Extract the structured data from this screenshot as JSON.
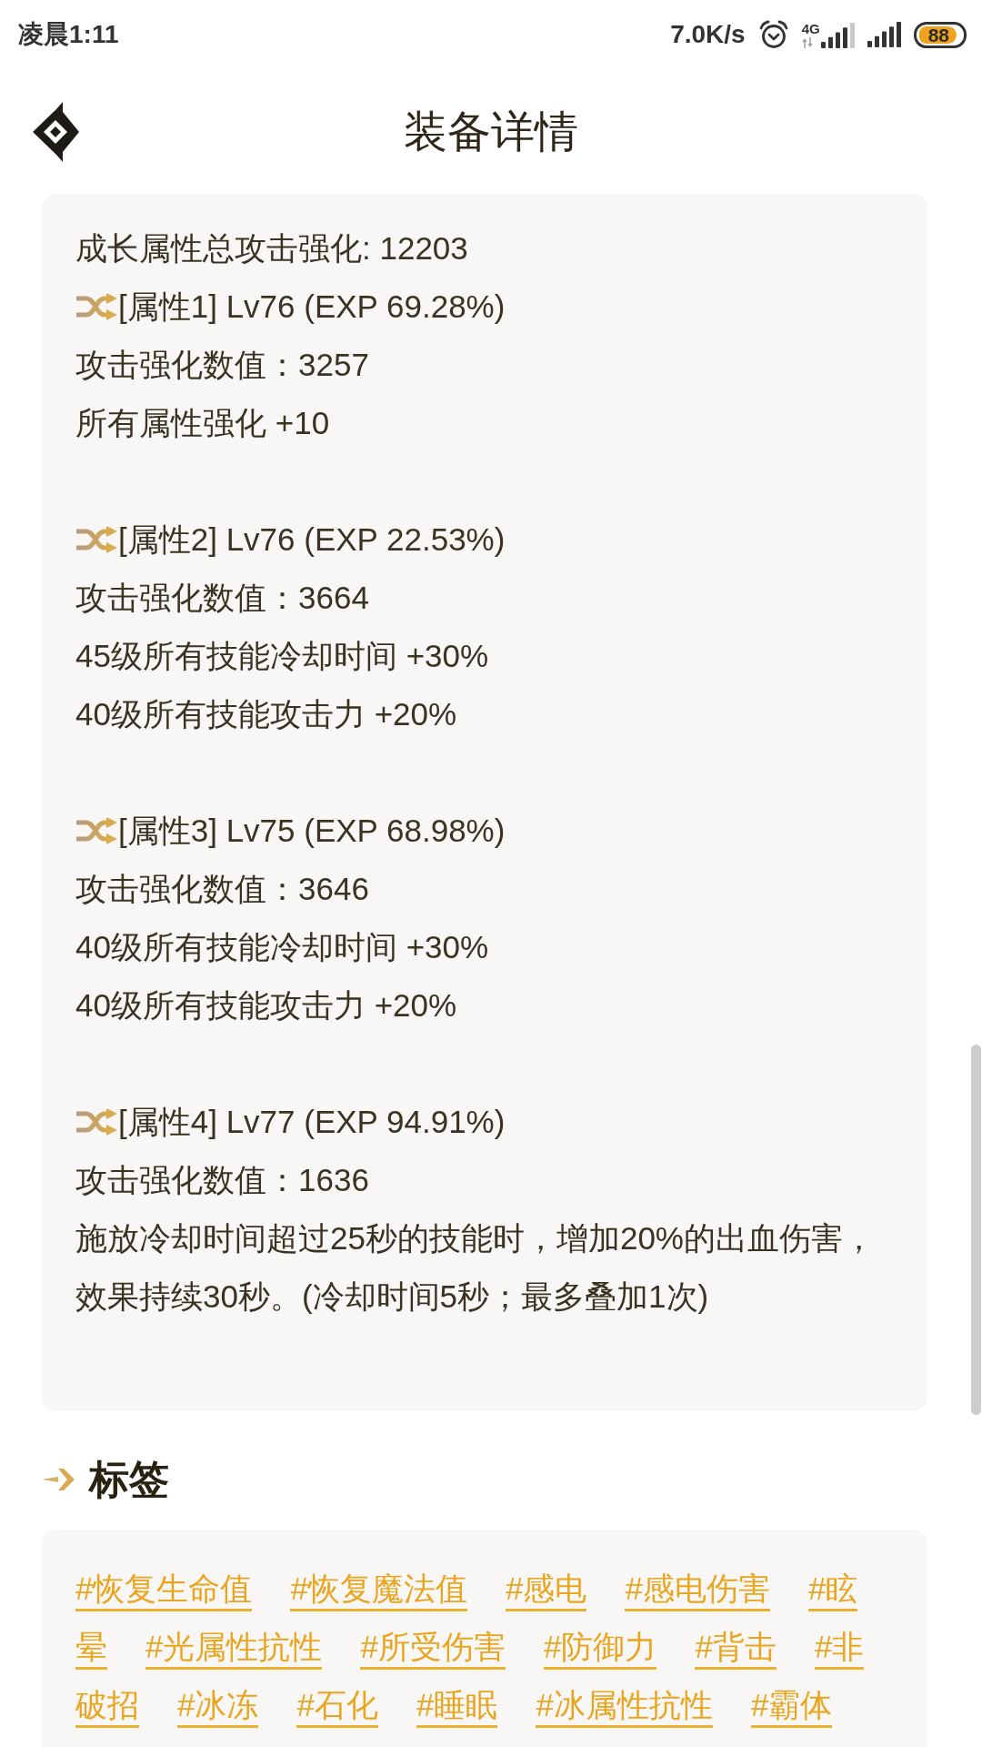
{
  "status_bar": {
    "time": "凌晨1:11",
    "network_speed": "7.0K/s",
    "network_type": "4G",
    "battery": "88"
  },
  "header": {
    "title": "装备详情"
  },
  "growth_card": {
    "total": "成长属性总攻击强化: 12203",
    "attributes": [
      {
        "title": "[属性1] Lv76 (EXP 69.28%)",
        "lines": [
          "攻击强化数值：3257",
          "所有属性强化 +10"
        ]
      },
      {
        "title": "[属性2] Lv76 (EXP 22.53%)",
        "lines": [
          "攻击强化数值：3664",
          "45级所有技能冷却时间 +30%",
          "40级所有技能攻击力 +20%"
        ]
      },
      {
        "title": "[属性3] Lv75 (EXP 68.98%)",
        "lines": [
          "攻击强化数值：3646",
          "40级所有技能冷却时间 +30%",
          "40级所有技能攻击力 +20%"
        ]
      },
      {
        "title": "[属性4] Lv77 (EXP 94.91%)",
        "lines": [
          "攻击强化数值：1636",
          "施放冷却时间超过25秒的技能时，增加20%的出血伤害，效果持续30秒。(冷却时间5秒；最多叠加1次)"
        ]
      }
    ]
  },
  "tags_section": {
    "title": "标签",
    "tags": [
      {
        "parts": [
          "#恢复生命值"
        ]
      },
      {
        "parts": [
          "#恢复魔法值"
        ]
      },
      {
        "parts": [
          "#感电"
        ]
      },
      {
        "parts": [
          "#感电伤害"
        ]
      },
      {
        "parts": [
          "#眩",
          "晕"
        ]
      },
      {
        "parts": [
          "#光属性抗性"
        ]
      },
      {
        "parts": [
          "#所受伤害"
        ]
      },
      {
        "parts": [
          "#防御力"
        ]
      },
      {
        "parts": [
          "#背击"
        ]
      },
      {
        "parts": [
          "#非",
          "破招"
        ]
      },
      {
        "parts": [
          "#冰冻"
        ]
      },
      {
        "parts": [
          "#石化"
        ]
      },
      {
        "parts": [
          "#睡眠"
        ]
      },
      {
        "parts": [
          "#冰属性抗性"
        ]
      },
      {
        "parts": [
          "#霸体"
        ]
      }
    ]
  }
}
